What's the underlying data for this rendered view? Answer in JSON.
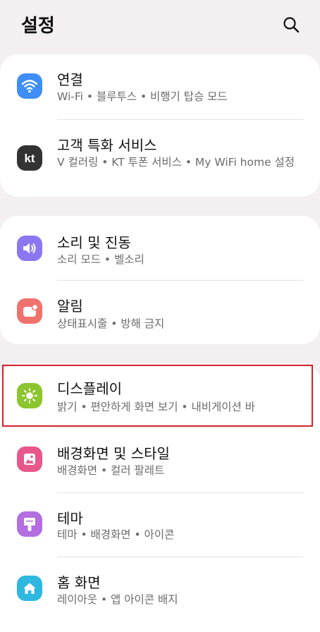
{
  "header": {
    "title": "설정"
  },
  "items": [
    {
      "title": "연결",
      "sub": "Wi-Fi • 블루투스 • 비행기 탑승 모드",
      "icon": "wifi-icon",
      "color": "#3f8ef7"
    },
    {
      "title": "고객 특화 서비스",
      "sub": "V 컬러링 • KT 투폰 서비스 • My WiFi home 설정",
      "icon": "kt-logo-icon",
      "color": "#333333"
    },
    {
      "title": "소리 및 진동",
      "sub": "소리 모드 • 벨소리",
      "icon": "speaker-icon",
      "color": "#8c76f2"
    },
    {
      "title": "알림",
      "sub": "상태표시줄 • 방해 금지",
      "icon": "notification-icon",
      "color": "#f0726c"
    },
    {
      "title": "디스플레이",
      "sub": "밝기 • 편안하게 화면 보기 • 내비게이션 바",
      "icon": "sun-icon",
      "color": "#8cc52d"
    },
    {
      "title": "배경화면 및 스타일",
      "sub": "배경화면 • 컬러 팔레트",
      "icon": "wallpaper-icon",
      "color": "#e8568b"
    },
    {
      "title": "테마",
      "sub": "테마 • 배경화면 • 아이콘",
      "icon": "theme-brush-icon",
      "color": "#b36ee0"
    },
    {
      "title": "홈 화면",
      "sub": "레이아웃 • 앱 아이콘 배지",
      "icon": "home-icon",
      "color": "#2eb8e0"
    }
  ]
}
